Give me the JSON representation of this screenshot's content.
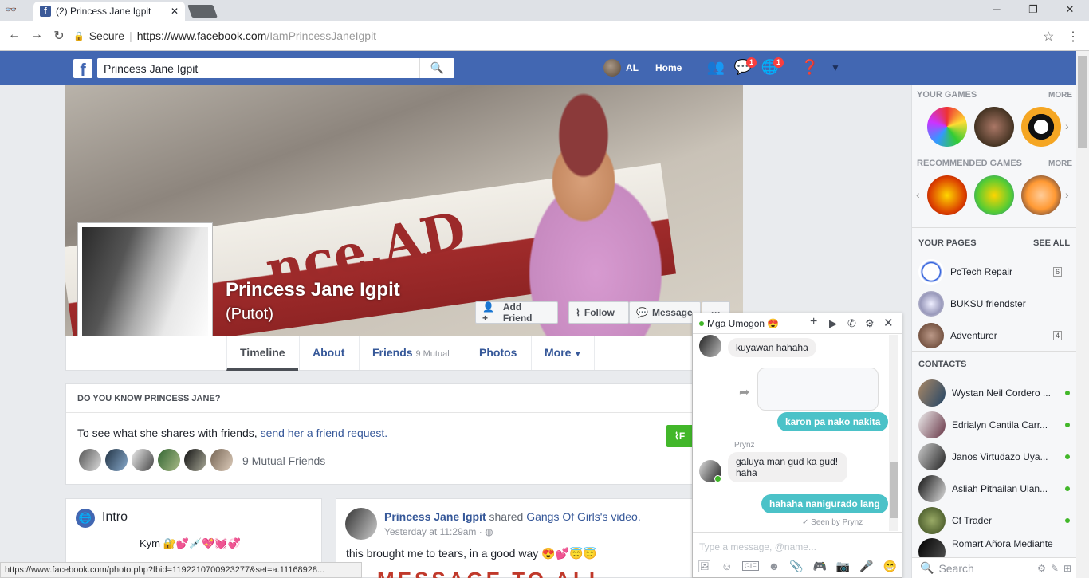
{
  "browser": {
    "tab_title": "(2) Princess Jane Igpit",
    "secure_label": "Secure",
    "url_host": "https://www.facebook.com",
    "url_path": "/IamPrincessJaneIgpit",
    "status_link": "https://www.facebook.com/photo.php?fbid=1192210700923277&set=a.11168928..."
  },
  "header": {
    "search_value": "Princess Jane Igpit",
    "user_name": "AL",
    "home_label": "Home",
    "messages_badge": "1",
    "notifications_badge": "1"
  },
  "profile": {
    "name": "Princess Jane Igpit",
    "nickname": "(Putot)",
    "cover_text": "nce,AD",
    "buttons": {
      "add_friend": "Add Friend",
      "follow": "Follow",
      "message": "Message",
      "more": "···"
    },
    "tabs": [
      {
        "label": "Timeline"
      },
      {
        "label": "About"
      },
      {
        "label": "Friends",
        "sub": "9 Mutual"
      },
      {
        "label": "Photos"
      },
      {
        "label": "More"
      }
    ]
  },
  "dyk": {
    "title": "DO YOU KNOW PRINCESS JANE?",
    "text": "To see what she shares with friends, ",
    "link": "send her a friend request.",
    "mutual": "9 Mutual Friends",
    "button": "F"
  },
  "intro": {
    "title": "Intro",
    "bio": "Kym 🔐💕💉💖💓💞"
  },
  "post": {
    "author": "Princess Jane Igpit",
    "action": " shared ",
    "target": "Gangs Of Girls",
    "suffix": "'s video.",
    "time": "Yesterday at 11:29am ·",
    "text": "this brought me to tears, in a good way 😍💕😇😇",
    "image_text": "A MESSAGE TO ALL"
  },
  "sidebar": {
    "your_games": "YOUR GAMES",
    "recommended_games": "RECOMMENDED GAMES",
    "more": "MORE",
    "your_pages": "YOUR PAGES",
    "see_all": "SEE ALL",
    "pages": [
      {
        "name": "PcTech Repair",
        "count": "6"
      },
      {
        "name": "BUKSU friendster",
        "count": ""
      },
      {
        "name": "Adventurer",
        "count": "4"
      }
    ],
    "contacts_title": "CONTACTS",
    "contacts": [
      {
        "name": "Wystan Neil Cordero ..."
      },
      {
        "name": "Edrialyn Cantila Carr..."
      },
      {
        "name": "Janos Virtudazo Uya..."
      },
      {
        "name": "Asliah Pithailan Ulan..."
      },
      {
        "name": "Cf Trader"
      },
      {
        "name": "Romart Añora Mediante"
      }
    ],
    "search_placeholder": "Search"
  },
  "chat": {
    "title": "Mga Umogon 😍",
    "messages": {
      "m1": "kuyawan hahaha",
      "m2": "karon pa nako nakita",
      "sender": "Prynz",
      "m3a": "galuya man gud ka gud!",
      "m3b": "haha",
      "m4": "hahaha nanigurado lang",
      "seen": "✓ Seen by Prynz"
    },
    "input_placeholder": "Type a message, @name..."
  }
}
